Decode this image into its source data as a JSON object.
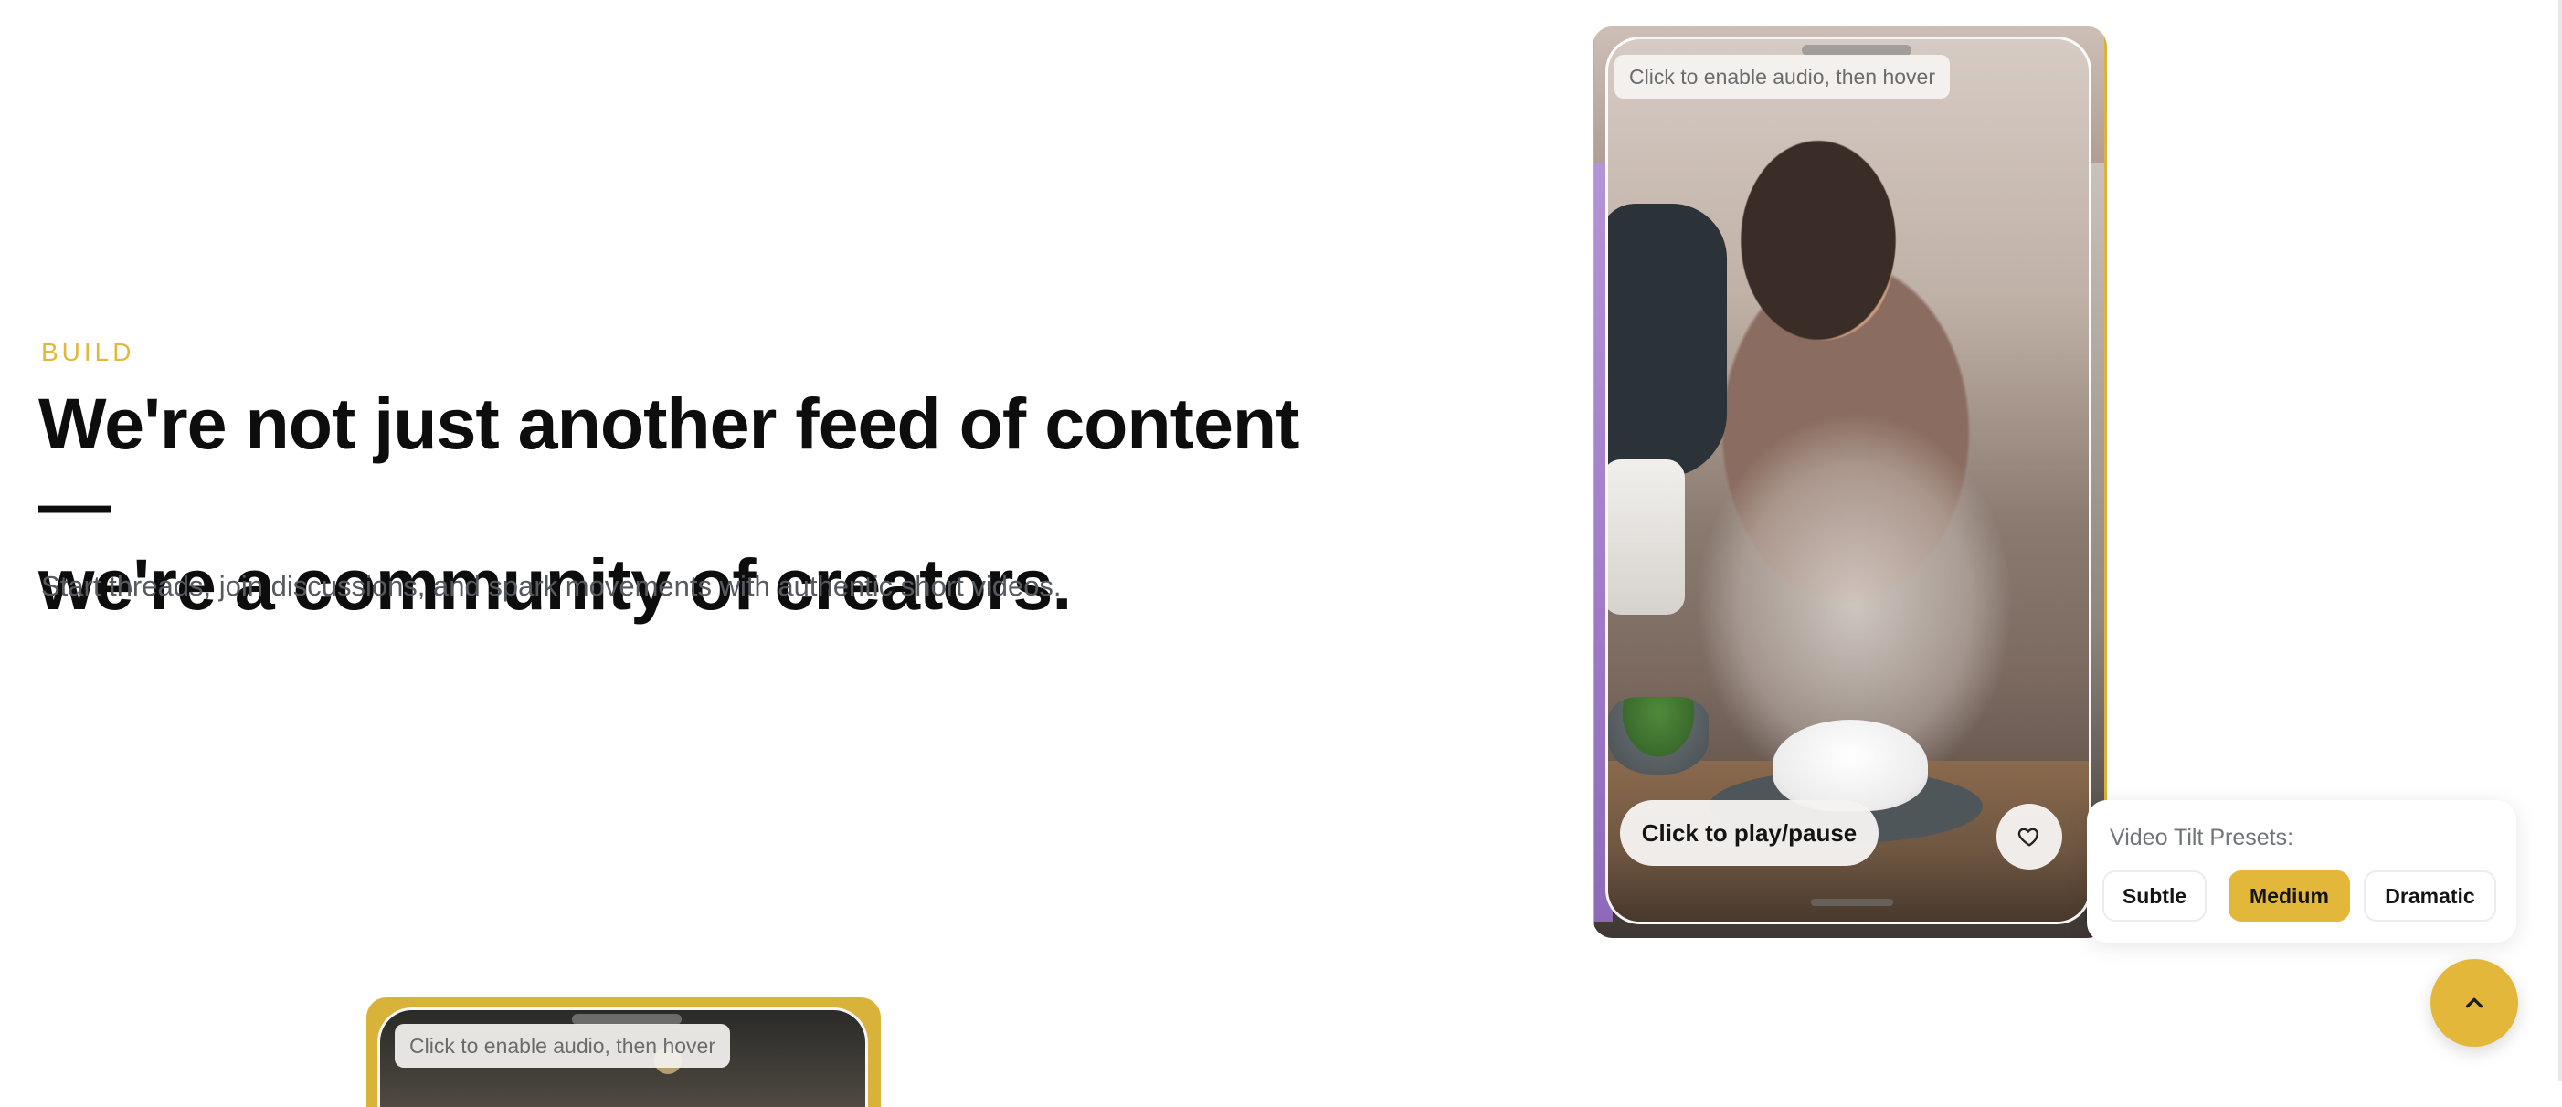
{
  "hero": {
    "eyebrow": "BUILD",
    "headline_line1": "We're not just another feed of content —",
    "headline_line2": "we're a community of creators.",
    "subtitle": "Start threads, join discussions, and spark movements with authentic short videos."
  },
  "video_card": {
    "audio_hint": "Click to enable audio, then hover",
    "play_label": "Click to play/pause",
    "like_icon": "heart-icon"
  },
  "tilt_presets": {
    "label": "Video Tilt Presets:",
    "options": [
      "Subtle",
      "Medium",
      "Dramatic"
    ],
    "selected": "Medium"
  },
  "second_card": {
    "audio_hint": "Click to enable audio, then hover"
  },
  "scroll_top": {
    "icon": "chevron-up-icon"
  },
  "colors": {
    "accent": "#e3b83a",
    "card_frame": "#d9b23a",
    "headline": "#0d0d0d",
    "subtitle": "#555a60"
  }
}
